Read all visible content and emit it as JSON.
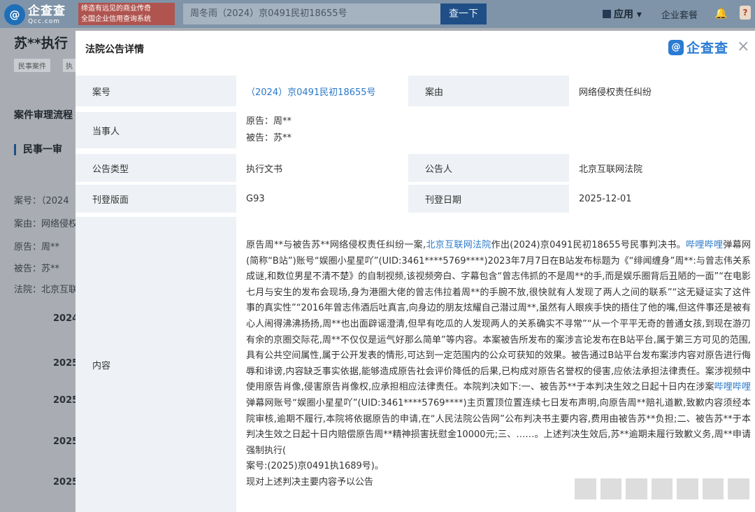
{
  "topbar": {
    "logo_main": "企查查",
    "logo_sub": "Qcc.com",
    "logo_mark": "@",
    "slogan_line1": "缔造有远见的商业传奇",
    "slogan_line2": "全国企业信用查询系统",
    "search_value": "周冬雨（2024）京0491民初18655号",
    "search_button": "查一下",
    "apps_label": "应用",
    "enterprise_label": "企业套餐",
    "info_badge": "?"
  },
  "background_page": {
    "title": "苏**执行",
    "tag1": "民事案件",
    "tag2": "执",
    "flow_title": "案件审理流程",
    "stage": "民事一审",
    "fields": [
      {
        "label": "案号：",
        "value": "（2024"
      },
      {
        "label": "案由：",
        "value": "网络侵权"
      },
      {
        "label": "原告：",
        "value": "周**"
      },
      {
        "label": "被告：",
        "value": "苏**"
      },
      {
        "label": "法院：",
        "value": "北京互联"
      }
    ],
    "years": [
      "2024",
      "2025",
      "2025",
      "2025",
      "2025"
    ]
  },
  "modal": {
    "title": "法院公告详情",
    "brand": "企查查",
    "brand_mark": "@",
    "close": "×",
    "rows": {
      "case_no_label": "案号",
      "case_no_value": "（2024）京0491民初18655号",
      "cause_label": "案由",
      "cause_value": "网络侵权责任纠纷",
      "parties_label": "当事人",
      "plaintiff": "原告：周**",
      "defendant": "被告：苏**",
      "type_label": "公告类型",
      "type_value": "执行文书",
      "announcer_label": "公告人",
      "announcer_value": "北京互联网法院",
      "page_label": "刊登版面",
      "page_value": "G93",
      "date_label": "刊登日期",
      "date_value": "2025-12-01",
      "content_label": "内容"
    },
    "content": {
      "p1_a": "原告周**与被告苏**网络侵权责任纠纷一案,",
      "p1_link1": "北京互联网法院",
      "p1_b": "作出(2024)京0491民初18655号民事判决书。",
      "p1_link2": "哔哩哔哩",
      "p1_c": "弹幕网(简称“B站”)账号“娱圈小星星吖”(UID:3461****5769****)2023年7月7日在B站发布标题为《“绯闻缠身”周**:与曾志伟关系成谜,和数位男星不清不楚》的自制视频,该视频旁白、字幕包含“曾志伟抓的不是周**的手,而是娱乐圈背后丑陋的一面”“在电影七月与安生的发布会现场,身为港圈大佬的曾志伟拉着周**的手腕不放,很快就有人发现了两人之间的联系”“这无疑证实了这件事的真实性”“2016年曾志伟酒后吐真言,向身边的朋友炫耀自己潜过周**,虽然有人眼疾手快的捂住了他的嘴,但这件事还是被有心人闹得沸沸扬扬,周**也出面辟谣澄清,但早有吃瓜的人发现两人的关系确实不寻常”“从一个平平无奇的普通女孩,到现在游刃有余的京圈交际花,周**不仅仅是运气好那么简单”等内容。本案被告所发布的案涉言论发布在B站平台,属于第三方可见的范围,具有公共空间属性,属于公开发表的情形,可达到一定范围内的公众可获知的效果。被告通过B站平台发布案涉内容对原告进行侮辱和诽谤,内容缺乏事实依据,能够造成原告社会评价降低的后果,已构成对原告名誉权的侵害,应依法承担法律责任。案涉视频中使用原告肖像,侵害原告肖像权,应承担相应法律责任。本院判决如下:一、被告苏**于本判决生效之日起十日内在涉案",
      "p1_link3": "哔哩哔哩",
      "p1_d": "弹幕网账号“娱圈小星星吖”(UID:3461****5769****)主页置顶位置连续七日发布声明,向原告周**赔礼道歉,致歉内容须经本院审核,逾期不履行,本院将依据原告的申请,在“人民法院公告网”公布判决书主要内容,费用由被告苏**负担;二、被告苏**于本判决生效之日起十日内赔偿原告周**精神损害抚慰金10000元;三、……。上述判决生效后,苏**逾期未履行致歉义务,周**申请强制执行(",
      "p2": "案号:(2025)京0491执1689号)。",
      "p3": "现对上述判决主要内容予以公告"
    }
  }
}
